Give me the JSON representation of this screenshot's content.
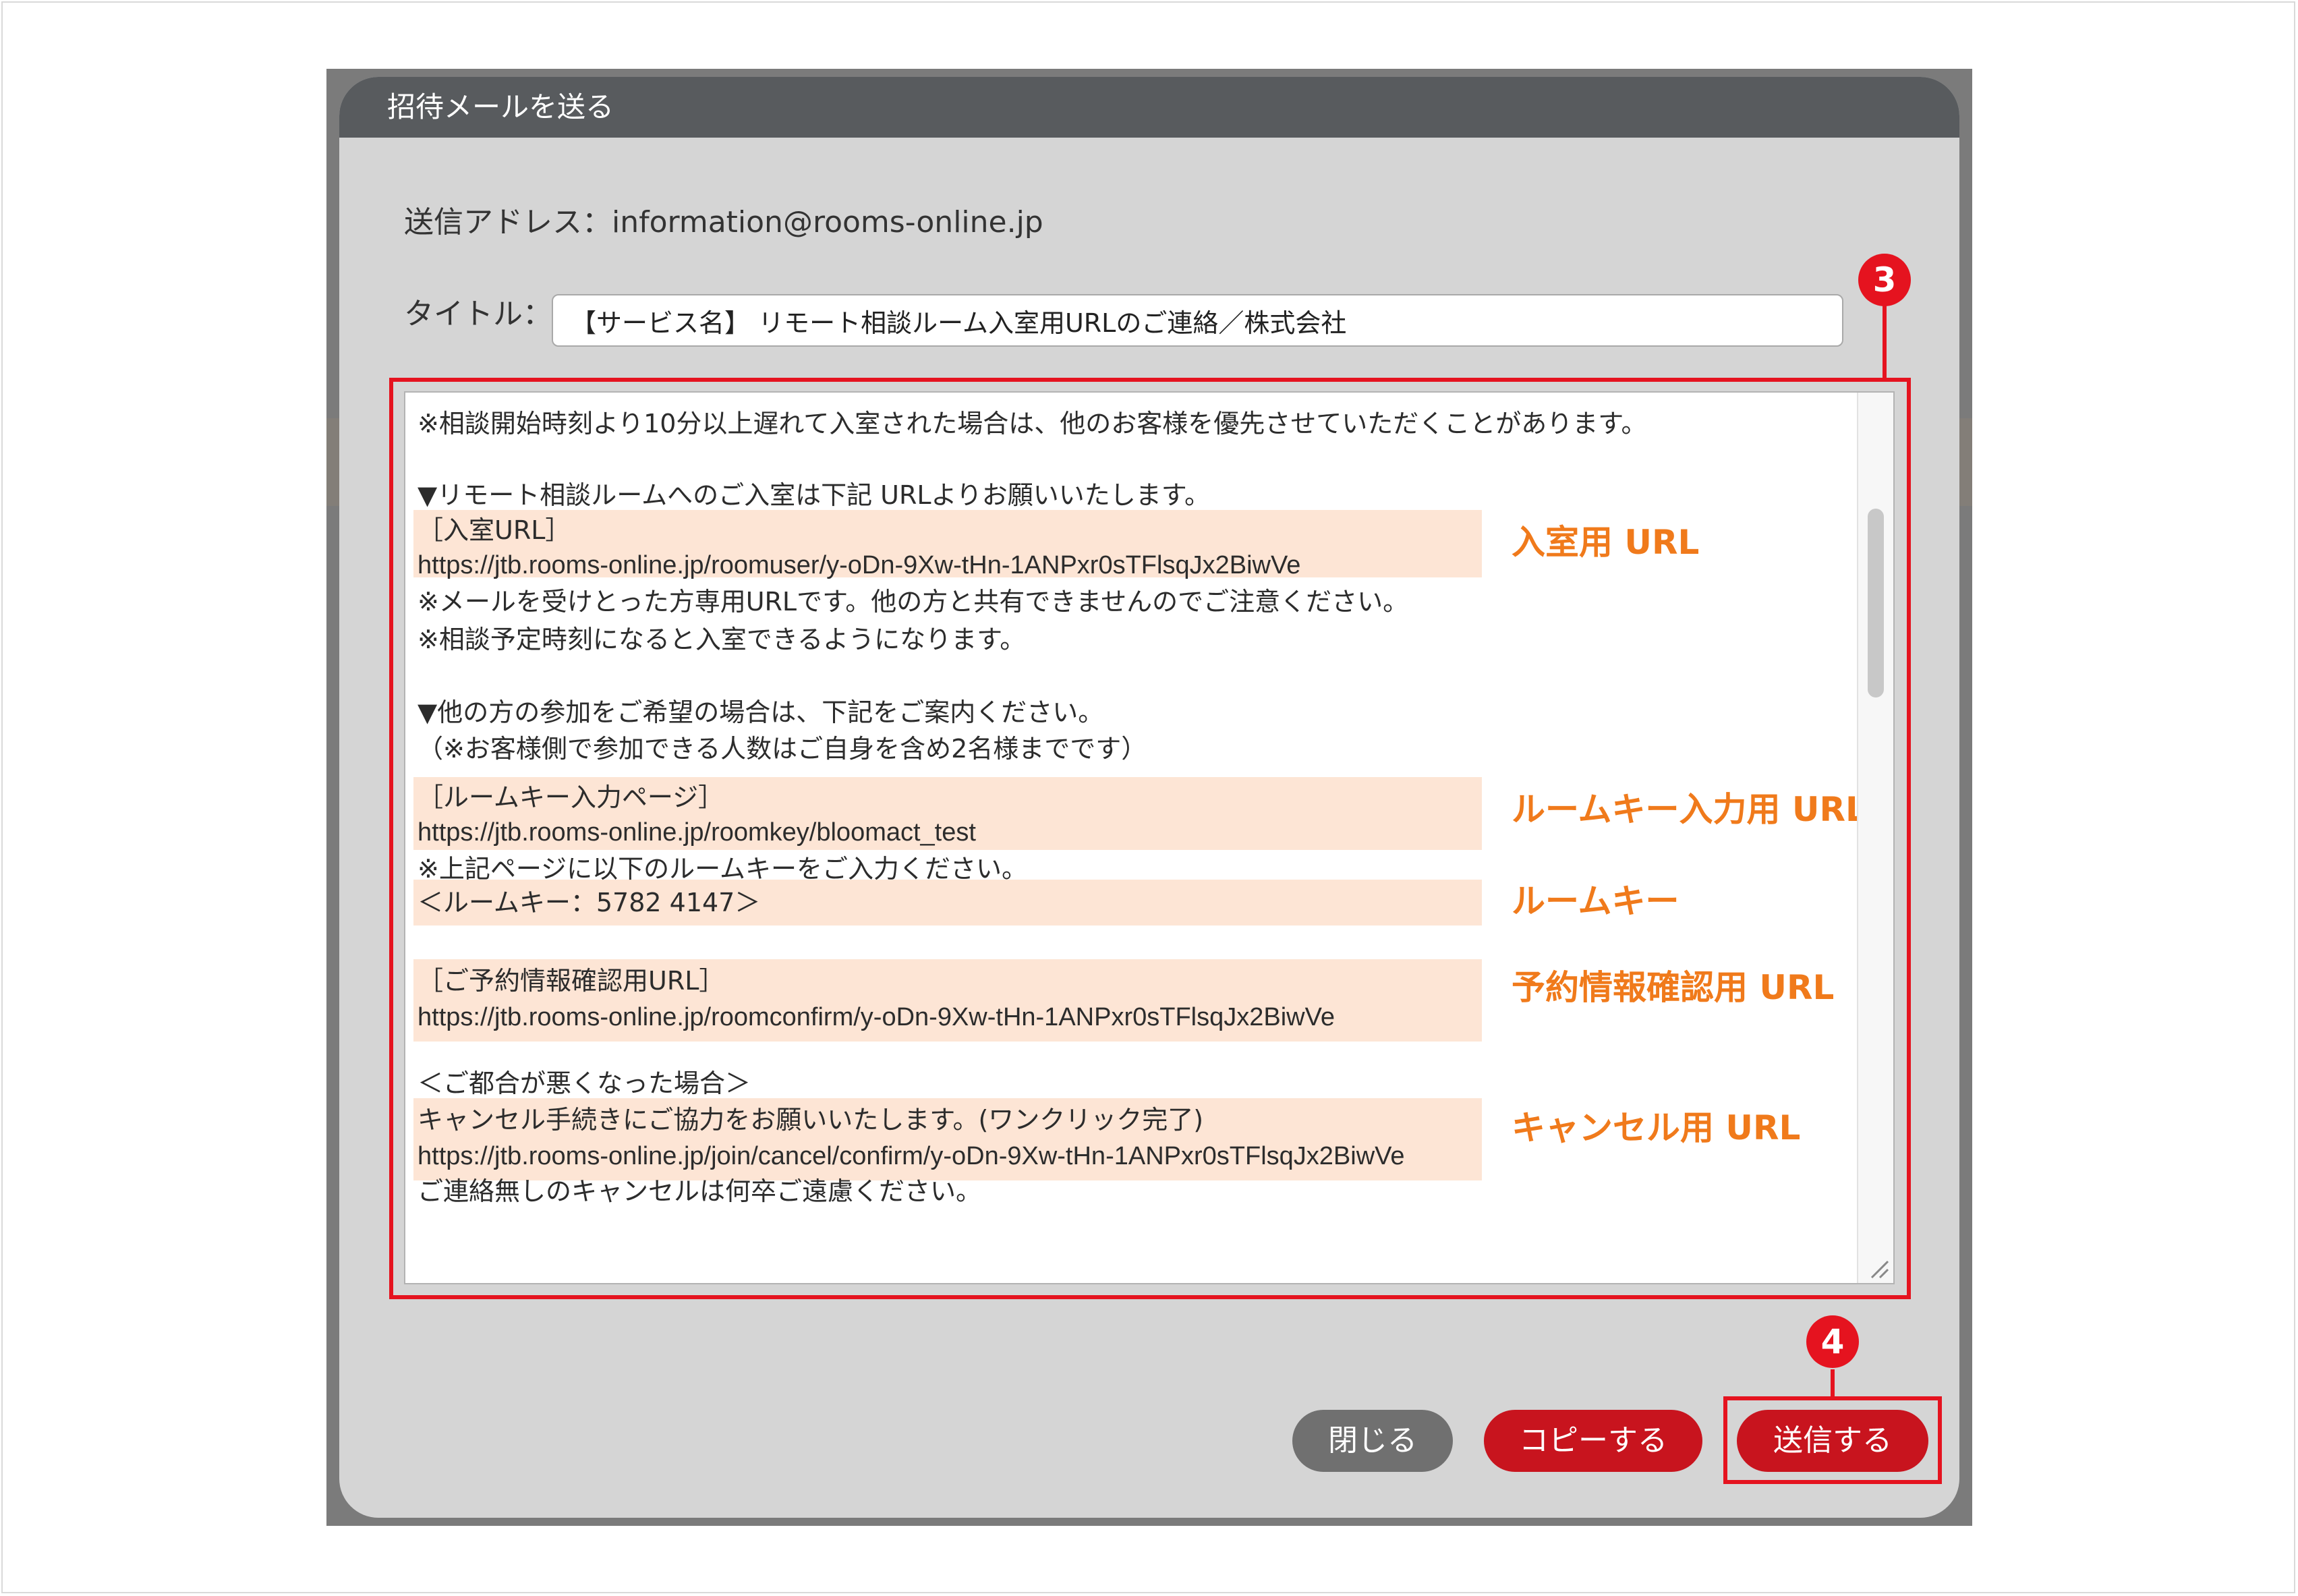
{
  "dialog": {
    "title": "招待メールを送る",
    "sender_address_label": "送信アドレス：information@rooms-online.jp",
    "title_label": "タイトル：",
    "title_value": "【サービス名】 リモート相談ルーム入室用URLのご連絡／株式会社"
  },
  "mail_body": {
    "lines": [
      "※相談開始時刻より10分以上遅れて入室された場合は、他のお客様を優先させていただくことがあります。",
      "▼リモート相談ルームへのご入室は下記 URLよりお願いいたします。",
      "［入室URL］",
      "https://jtb.rooms-online.jp/roomuser/y-oDn-9Xw-tHn-1ANPxr0sTFlsqJx2BiwVe",
      "※メールを受けとった方専用URLです。他の方と共有できませんのでご注意ください。",
      "※相談予定時刻になると入室できるようになります。",
      "▼他の方の参加をご希望の場合は、下記をご案内ください。",
      "（※お客様側で参加できる人数はご自身を含め2名様までです）",
      "［ルームキー入力ページ］",
      "https://jtb.rooms-online.jp/roomkey/bloomact_test",
      "※上記ページに以下のルームキーをご入力ください。",
      "＜ルームキー：5782 4147＞",
      "［ご予約情報確認用URL］",
      "https://jtb.rooms-online.jp/roomconfirm/y-oDn-9Xw-tHn-1ANPxr0sTFlsqJx2BiwVe",
      "＜ご都合が悪くなった場合＞",
      "キャンセル手続きにご協力をお願いいたします。(ワンクリック完了)",
      "https://jtb.rooms-online.jp/join/cancel/confirm/y-oDn-9Xw-tHn-1ANPxr0sTFlsqJx2BiwVe",
      "ご連絡無しのキャンセルは何卒ご遠慮ください。"
    ]
  },
  "callouts": {
    "entry_url": "入室用 URL",
    "roomkey_url": "ルームキー入力用 URL",
    "roomkey": "ルームキー",
    "reservation_url": "予約情報確認用 URL",
    "cancel_url": "キャンセル用 URL"
  },
  "steps": {
    "step3": "3",
    "step4": "4"
  },
  "buttons": {
    "close": "閉じる",
    "copy": "コピーする",
    "send": "送信する"
  },
  "colors": {
    "header": "#585b5e",
    "dialog_bg": "#d5d5d5",
    "highlight": "#fde5d5",
    "callout_text": "#f07a1b",
    "annotation_red": "#e5131f",
    "primary_button": "#c8141e",
    "close_button": "#707070"
  }
}
